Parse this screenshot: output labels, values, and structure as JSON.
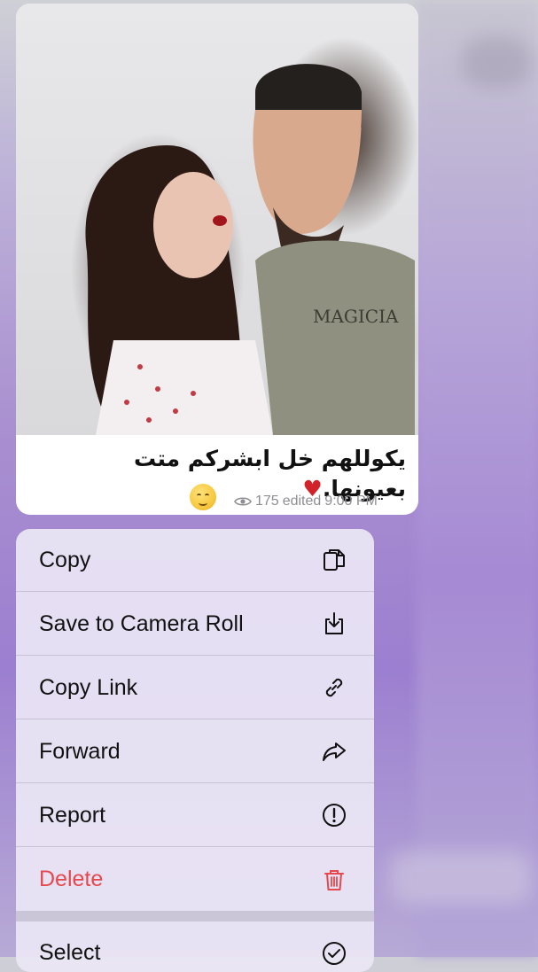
{
  "message": {
    "caption_text": "يكوللهم خل ابشركم متت بعيونها.",
    "caption_heart": "♥",
    "emoji": "relieved-face",
    "views": "175",
    "edited_label": "edited",
    "time": "9:00 PM"
  },
  "menu": {
    "items": [
      {
        "label": "Copy",
        "icon": "copy-icon"
      },
      {
        "label": "Save to Camera Roll",
        "icon": "save-icon"
      },
      {
        "label": "Copy Link",
        "icon": "link-icon"
      },
      {
        "label": "Forward",
        "icon": "forward-icon"
      },
      {
        "label": "Report",
        "icon": "report-icon"
      },
      {
        "label": "Delete",
        "icon": "trash-icon"
      },
      {
        "label": "Select",
        "icon": "check-circle-icon"
      }
    ]
  },
  "colors": {
    "danger": "#e5484d",
    "accent_bg": "#9c7fd0"
  }
}
